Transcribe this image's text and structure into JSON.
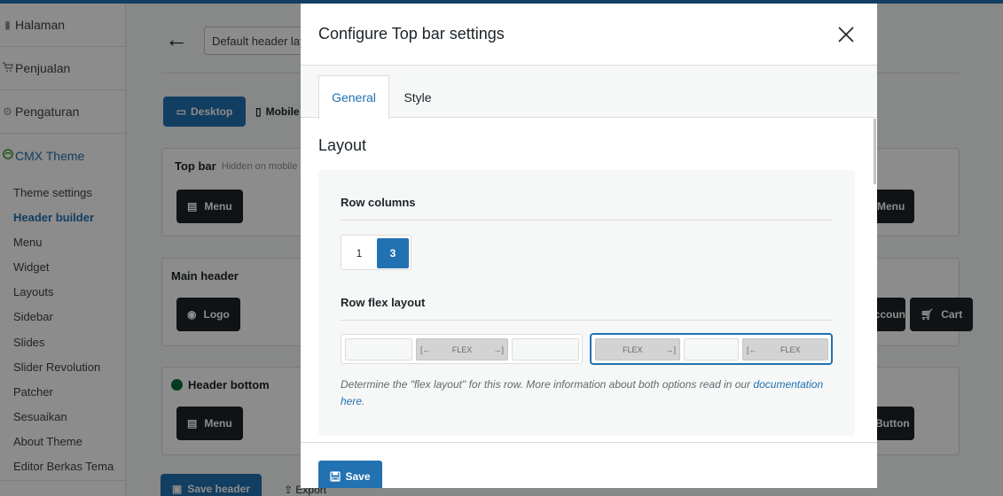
{
  "sidebar": {
    "menu": [
      {
        "label": "Halaman",
        "icon": "page-icon"
      },
      {
        "label": "Penjualan",
        "icon": "cart-icon"
      },
      {
        "label": "Pengaturan",
        "icon": "gear-icon"
      },
      {
        "label": "CMX Theme",
        "icon": "theme-icon"
      }
    ],
    "submenu": [
      "Theme settings",
      "Header builder",
      "Menu",
      "Widget",
      "Layouts",
      "Sidebar",
      "Slides",
      "Slider Revolution",
      "Patcher",
      "Sesuaikan",
      "About Theme",
      "Editor Berkas Tema"
    ]
  },
  "background": {
    "layout_select": "Default header layout",
    "device_desktop": "Desktop",
    "device_mobile": "Mobile",
    "rows": {
      "top_bar": "Top bar",
      "top_bar_hidden": "Hidden on mobile",
      "main_header": "Main header",
      "header_bottom": "Header bottom"
    },
    "items": {
      "menu": "Menu",
      "logo": "Logo",
      "account": "Account",
      "cart": "Cart",
      "menu_right": "Menu",
      "button_right": "Button"
    },
    "save_header": "Save header",
    "export": "Export"
  },
  "modal": {
    "title": "Configure Top bar settings",
    "tabs": [
      "General",
      "Style"
    ],
    "active_tab": "General",
    "section_title": "Layout",
    "row_columns": {
      "label": "Row columns",
      "options": [
        "1",
        "3"
      ],
      "selected": "3"
    },
    "row_flex_layout": {
      "label": "Row flex layout",
      "flex_text": "FLEX",
      "selected_option": 2
    },
    "help_text": "Determine the \"flex layout\" for this row. More information about both options read in our",
    "help_link": "documentation here",
    "help_end": ".",
    "save_label": "Save"
  },
  "colors": {
    "accent": "#2271b1",
    "dark": "#1d2327",
    "theme_green": "#3a9d3a"
  }
}
